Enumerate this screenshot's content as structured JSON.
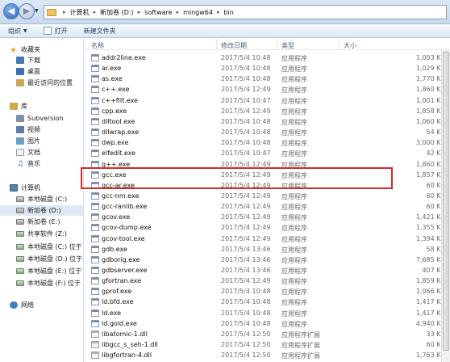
{
  "address": {
    "crumbs": [
      "计算机",
      "新加卷 (D:)",
      "software",
      "mingw64",
      "bin"
    ]
  },
  "toolbar": {
    "organize_label": "组织",
    "open_label": "打开",
    "new_folder_label": "新建文件夹"
  },
  "nav": {
    "favorites": "收藏夹",
    "downloads": "下载",
    "desktop": "桌面",
    "recent": "最近访问的位置",
    "libraries": "库",
    "subversion": "Subversion",
    "videos": "视频",
    "pictures": "图片",
    "documents": "文档",
    "music": "音乐",
    "computer": "计算机",
    "drive_c": "本地磁盘 (C:)",
    "drive_d": "新加卷 (D:)",
    "drive_e": "新加卷 (E:)",
    "drive_z": "共享软件 (Z:)",
    "net_drive_1": "本地磁盘 (C:) 位于 X",
    "net_drive_2": "本地磁盘 (D:) 位于 X",
    "net_drive_3": "本地磁盘 (E:) 位于 X",
    "net_drive_4": "本地磁盘 (F:) 位于 X",
    "network": "网络"
  },
  "columns": {
    "name": "名称",
    "date": "修改日期",
    "type": "类型",
    "size": "大小"
  },
  "files": [
    {
      "name": "addr2line.exe",
      "date": "2017/5/4 10:48",
      "type": "应用程序",
      "size": "1,003 KB"
    },
    {
      "name": "ar.exe",
      "date": "2017/5/4 10:48",
      "type": "应用程序",
      "size": "1,029 KB"
    },
    {
      "name": "as.exe",
      "date": "2017/5/4 10:48",
      "type": "应用程序",
      "size": "1,770 KB"
    },
    {
      "name": "c++.exe",
      "date": "2017/5/4 12:49",
      "type": "应用程序",
      "size": "1,860 KB"
    },
    {
      "name": "c++filt.exe",
      "date": "2017/5/4 10:47",
      "type": "应用程序",
      "size": "1,001 KB"
    },
    {
      "name": "cpp.exe",
      "date": "2017/5/4 12:49",
      "type": "应用程序",
      "size": "1,858 KB"
    },
    {
      "name": "dlltool.exe",
      "date": "2017/5/4 10:48",
      "type": "应用程序",
      "size": "1,060 KB"
    },
    {
      "name": "dllwrap.exe",
      "date": "2017/5/4 10:48",
      "type": "应用程序",
      "size": "54 KB"
    },
    {
      "name": "dwp.exe",
      "date": "2017/5/4 10:48",
      "type": "应用程序",
      "size": "3,000 KB"
    },
    {
      "name": "elfedit.exe",
      "date": "2017/5/4 10:47",
      "type": "应用程序",
      "size": "42 KB"
    },
    {
      "name": "g++.exe",
      "date": "2017/5/4 12:49",
      "type": "应用程序",
      "size": "1,860 KB"
    },
    {
      "name": "gcc.exe",
      "date": "2017/5/4 12:49",
      "type": "应用程序",
      "size": "1,857 KB"
    },
    {
      "name": "gcc-ar.exe",
      "date": "2017/5/4 12:49",
      "type": "应用程序",
      "size": "60 KB"
    },
    {
      "name": "gcc-nm.exe",
      "date": "2017/5/4 12:49",
      "type": "应用程序",
      "size": "60 KB"
    },
    {
      "name": "gcc-ranlib.exe",
      "date": "2017/5/4 12:49",
      "type": "应用程序",
      "size": "60 KB"
    },
    {
      "name": "gcov.exe",
      "date": "2017/5/4 12:49",
      "type": "应用程序",
      "size": "1,421 KB"
    },
    {
      "name": "gcov-dump.exe",
      "date": "2017/5/4 12:49",
      "type": "应用程序",
      "size": "1,355 KB"
    },
    {
      "name": "gcov-tool.exe",
      "date": "2017/5/4 12:49",
      "type": "应用程序",
      "size": "1,394 KB"
    },
    {
      "name": "gdb.exe",
      "date": "2017/5/4 13:46",
      "type": "应用程序",
      "size": "58 KB"
    },
    {
      "name": "gdborig.exe",
      "date": "2017/5/4 13:46",
      "type": "应用程序",
      "size": "7,685 KB"
    },
    {
      "name": "gdbserver.exe",
      "date": "2017/5/4 13:46",
      "type": "应用程序",
      "size": "407 KB"
    },
    {
      "name": "gfortran.exe",
      "date": "2017/5/4 12:49",
      "type": "应用程序",
      "size": "1,859 KB"
    },
    {
      "name": "gprof.exe",
      "date": "2017/5/4 10:48",
      "type": "应用程序",
      "size": "1,066 KB"
    },
    {
      "name": "ld.bfd.exe",
      "date": "2017/5/4 10:48",
      "type": "应用程序",
      "size": "1,417 KB"
    },
    {
      "name": "ld.exe",
      "date": "2017/5/4 10:48",
      "type": "应用程序",
      "size": "1,417 KB"
    },
    {
      "name": "ld.gold.exe",
      "date": "2017/5/4 10:48",
      "type": "应用程序",
      "size": "4,940 KB"
    },
    {
      "name": "libatomic-1.dll",
      "date": "2017/5/4 12:50",
      "type": "应用程序扩展",
      "size": "33 KB"
    },
    {
      "name": "libgcc_s_seh-1.dll",
      "date": "2017/5/4 12:50",
      "type": "应用程序扩展",
      "size": "60 KB"
    },
    {
      "name": "libgfortran-4.dll",
      "date": "2017/5/4 12:50",
      "type": "应用程序扩展",
      "size": "1,763 KB"
    }
  ],
  "highlight_color": "#d42a2a",
  "selection_color": "#dfe8f5"
}
